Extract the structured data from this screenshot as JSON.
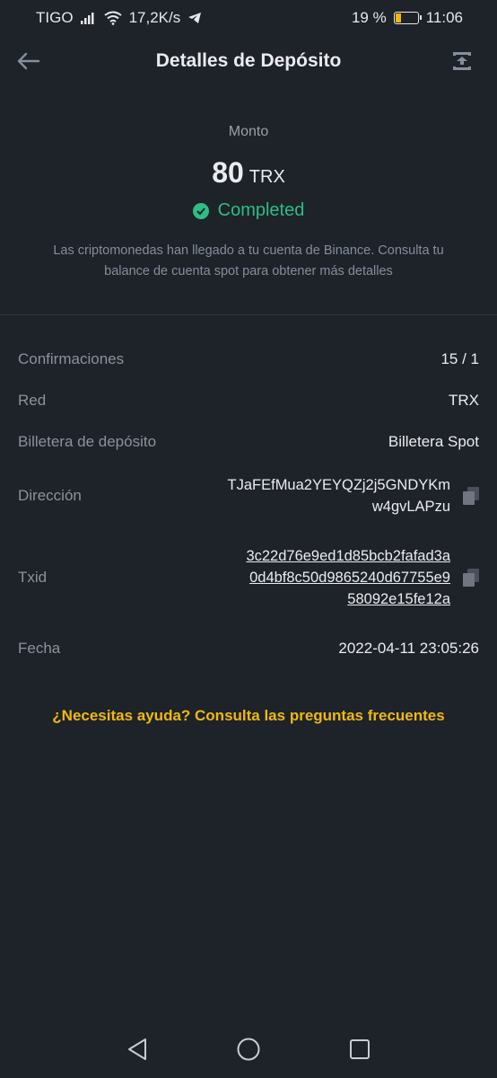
{
  "status_bar": {
    "carrier": "TIGO",
    "speed": "17,2K/s",
    "battery": "19 %",
    "time": "11:06"
  },
  "header": {
    "title": "Detalles de Depósito"
  },
  "summary": {
    "amount_label": "Monto",
    "amount": "80",
    "unit": "TRX",
    "status": "Completed",
    "description": "Las criptomonedas han llegado a tu cuenta de Binance. Consulta tu balance de cuenta spot para obtener más detalles"
  },
  "details": {
    "confirmations": {
      "label": "Confirmaciones",
      "value": "15 / 1"
    },
    "network": {
      "label": "Red",
      "value": "TRX"
    },
    "wallet": {
      "label": "Billetera de depósito",
      "value": "Billetera Spot"
    },
    "address": {
      "label": "Dirección",
      "line1": "TJaFEfMua2YEYQZj2j5GNDYKm",
      "line2": "w4gvLAPzu"
    },
    "txid": {
      "label": "Txid",
      "line1": "3c22d76e9ed1d85bcb2fafad3a",
      "line2": "0d4bf8c50d9865240d67755e9",
      "line3": "58092e15fe12a"
    },
    "date": {
      "label": "Fecha",
      "value": "2022-04-11 23:05:26"
    }
  },
  "help_link": "¿Necesitas ayuda? Consulta las preguntas frecuentes",
  "colors": {
    "background": "#1e2229",
    "accent": "#f0b90b",
    "success": "#2ebd85"
  }
}
